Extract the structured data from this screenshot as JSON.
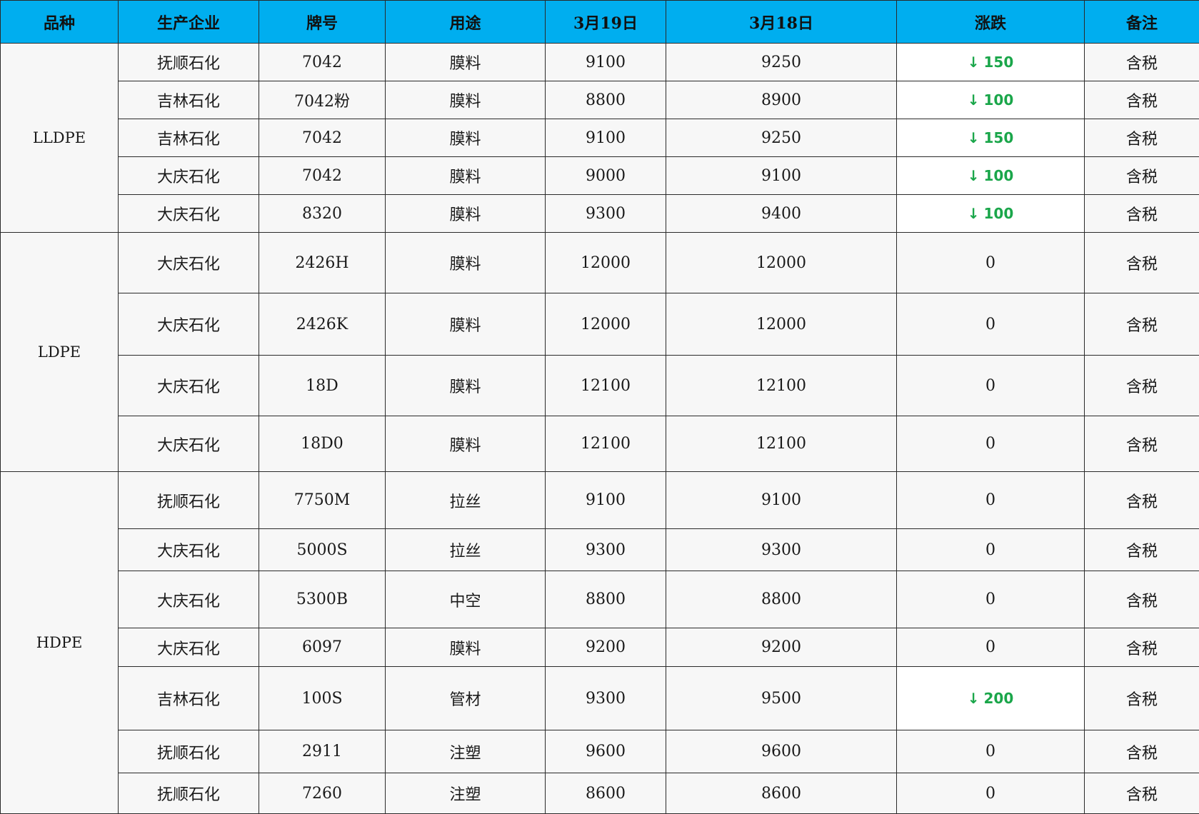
{
  "header": [
    "品种",
    "生产企业",
    "牌号",
    "用途",
    "3月19日",
    "3月18日",
    "涨跌",
    "备注"
  ],
  "down_arrow": "↓",
  "colors": {
    "header_bg": "#00aeef",
    "down": "#1aa64a",
    "cell_bg": "#f7f7f7"
  },
  "groups": [
    {
      "name": "LLDPE",
      "rows": [
        {
          "company": "抚顺石化",
          "grade": "7042",
          "use": "膜料",
          "mar19": "9100",
          "mar18": "9250",
          "change": "150",
          "dir": "down",
          "note": "含税"
        },
        {
          "company": "吉林石化",
          "grade": "7042粉",
          "use": "膜料",
          "mar19": "8800",
          "mar18": "8900",
          "change": "100",
          "dir": "down",
          "note": "含税"
        },
        {
          "company": "吉林石化",
          "grade": "7042",
          "use": "膜料",
          "mar19": "9100",
          "mar18": "9250",
          "change": "150",
          "dir": "down",
          "note": "含税"
        },
        {
          "company": "大庆石化",
          "grade": "7042",
          "use": "膜料",
          "mar19": "9000",
          "mar18": "9100",
          "change": "100",
          "dir": "down",
          "note": "含税"
        },
        {
          "company": "大庆石化",
          "grade": "8320",
          "use": "膜料",
          "mar19": "9300",
          "mar18": "9400",
          "change": "100",
          "dir": "down",
          "note": "含税"
        }
      ]
    },
    {
      "name": "LDPE",
      "rows": [
        {
          "company": "大庆石化",
          "grade": "2426H",
          "use": "膜料",
          "mar19": "12000",
          "mar18": "12000",
          "change": "0",
          "dir": "flat",
          "note": "含税"
        },
        {
          "company": "大庆石化",
          "grade": "2426K",
          "use": "膜料",
          "mar19": "12000",
          "mar18": "12000",
          "change": "0",
          "dir": "flat",
          "note": "含税"
        },
        {
          "company": "大庆石化",
          "grade": "18D",
          "use": "膜料",
          "mar19": "12100",
          "mar18": "12100",
          "change": "0",
          "dir": "flat",
          "note": "含税"
        },
        {
          "company": "大庆石化",
          "grade": "18D0",
          "use": "膜料",
          "mar19": "12100",
          "mar18": "12100",
          "change": "0",
          "dir": "flat",
          "note": "含税"
        }
      ]
    },
    {
      "name": "HDPE",
      "rows": [
        {
          "company": "抚顺石化",
          "grade": "7750M",
          "use": "拉丝",
          "mar19": "9100",
          "mar18": "9100",
          "change": "0",
          "dir": "flat",
          "note": "含税"
        },
        {
          "company": "大庆石化",
          "grade": "5000S",
          "use": "拉丝",
          "mar19": "9300",
          "mar18": "9300",
          "change": "0",
          "dir": "flat",
          "note": "含税"
        },
        {
          "company": "大庆石化",
          "grade": "5300B",
          "use": "中空",
          "mar19": "8800",
          "mar18": "8800",
          "change": "0",
          "dir": "flat",
          "note": "含税"
        },
        {
          "company": "大庆石化",
          "grade": "6097",
          "use": "膜料",
          "mar19": "9200",
          "mar18": "9200",
          "change": "0",
          "dir": "flat",
          "note": "含税"
        },
        {
          "company": "吉林石化",
          "grade": "100S",
          "use": "管材",
          "mar19": "9300",
          "mar18": "9500",
          "change": "200",
          "dir": "down",
          "note": "含税"
        },
        {
          "company": "抚顺石化",
          "grade": "2911",
          "use": "注塑",
          "mar19": "9600",
          "mar18": "9600",
          "change": "0",
          "dir": "flat",
          "note": "含税"
        },
        {
          "company": "抚顺石化",
          "grade": "7260",
          "use": "注塑",
          "mar19": "8600",
          "mar18": "8600",
          "change": "0",
          "dir": "flat",
          "note": "含税"
        }
      ]
    }
  ]
}
